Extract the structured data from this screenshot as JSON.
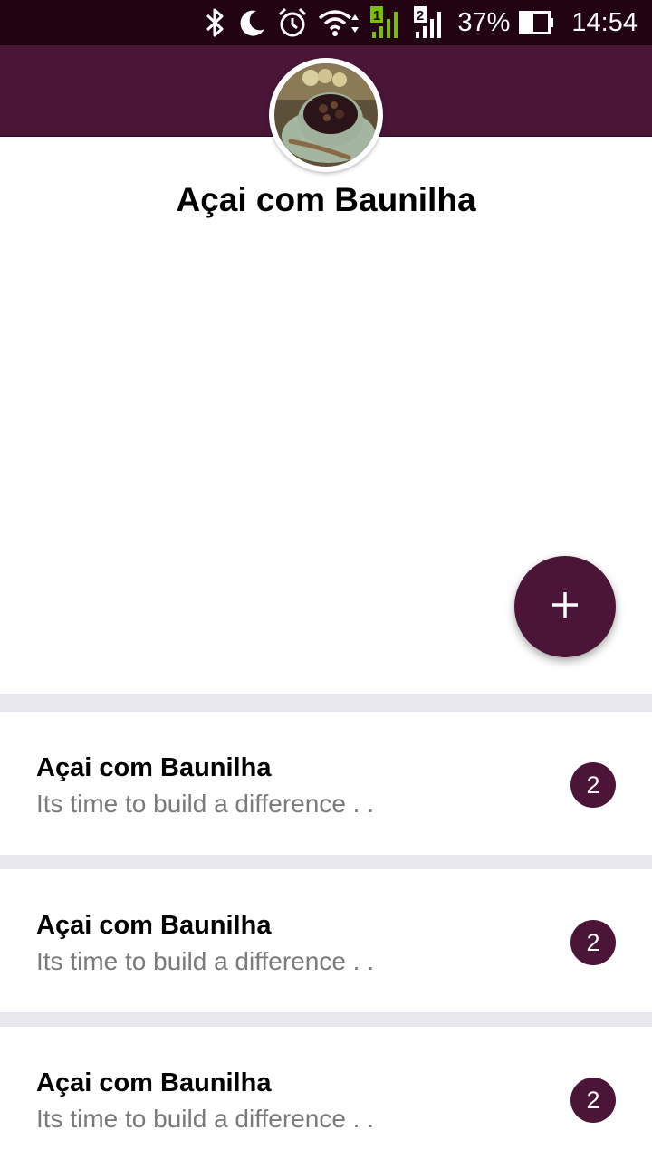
{
  "status_bar": {
    "battery": "37%",
    "time": "14:54",
    "sim1_label": "1",
    "sim2_label": "2",
    "icons": [
      "bluetooth-icon",
      "moon-icon",
      "alarm-icon",
      "wifi-icon",
      "signal-icon",
      "signal-icon",
      "battery-icon"
    ]
  },
  "colors": {
    "status_bar": "#220311",
    "primary": "#4a1537",
    "divider": "#e8e7ee",
    "subtitle_text": "#7a7a7a",
    "sim1_signal": "#79c100"
  },
  "header": {
    "title": "Açai com Baunilha",
    "avatar": "acai-bowl-photo"
  },
  "fab": {
    "icon": "plus-icon",
    "label": "+"
  },
  "list": [
    {
      "title": "Açai com Baunilha",
      "subtitle": "Its time to build a difference . .",
      "count": "2"
    },
    {
      "title": "Açai com Baunilha",
      "subtitle": "Its time to build a difference . .",
      "count": "2"
    },
    {
      "title": "Açai com Baunilha",
      "subtitle": "Its time to build a difference . .",
      "count": "2"
    }
  ]
}
